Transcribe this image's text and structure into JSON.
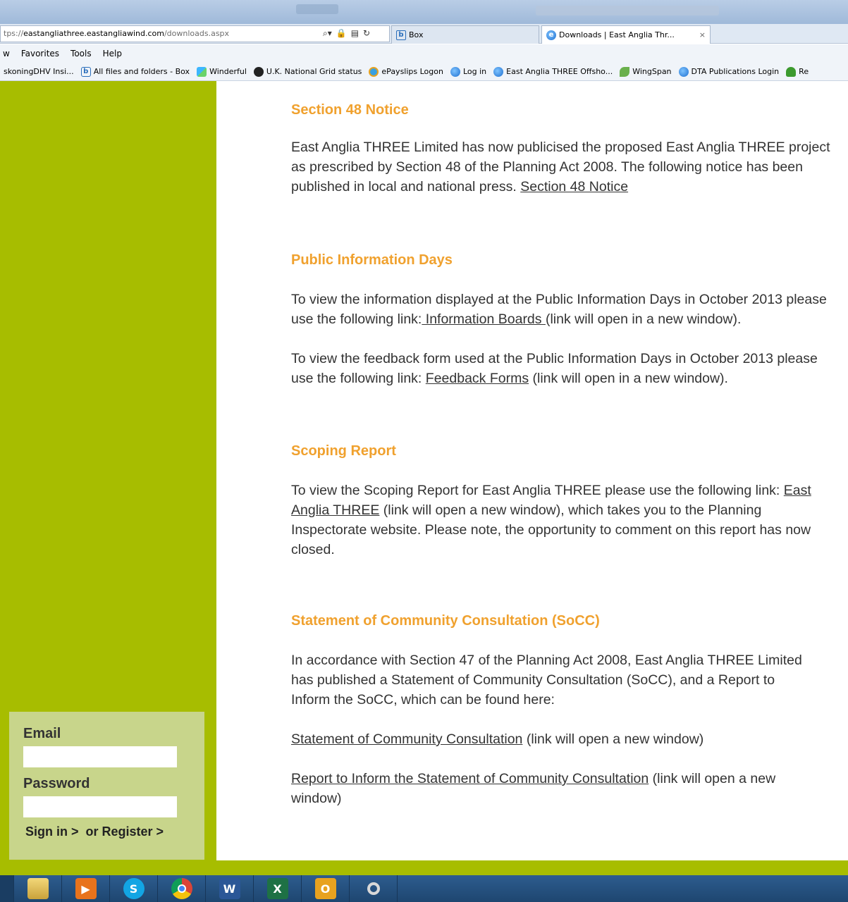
{
  "browser": {
    "address_prefix": "tps://",
    "address_host": "eastangliathree.eastangliawind.com",
    "address_path": "/downloads.aspx",
    "tabs": [
      {
        "label": "Box",
        "icon": "box-icon"
      },
      {
        "label": "Downloads | East Anglia Thr...",
        "icon": "ie-icon",
        "close": "×"
      }
    ],
    "menu": [
      "w",
      "Favorites",
      "Tools",
      "Help"
    ],
    "favorites": [
      {
        "label": "skoningDHV Insi...",
        "icon": ""
      },
      {
        "label": "All files and folders - Box",
        "icon": "box-icon"
      },
      {
        "label": "Winderful",
        "icon": "winderful-icon"
      },
      {
        "label": "U.K. National Grid status",
        "icon": "national-grid-icon"
      },
      {
        "label": "ePayslips Logon",
        "icon": "epayslips-icon"
      },
      {
        "label": "Log in",
        "icon": "ie-icon"
      },
      {
        "label": "East Anglia THREE Offsho...",
        "icon": "ie-icon"
      },
      {
        "label": "WingSpan",
        "icon": "wingspan-icon"
      },
      {
        "label": "DTA Publications  Login",
        "icon": "ie-icon"
      },
      {
        "label": "Re",
        "icon": "tree-icon"
      }
    ]
  },
  "sections": [
    {
      "heading": "Section 48 Notice",
      "paras": [
        {
          "text": "East Anglia THREE Limited has now publicised the proposed East Anglia THREE project as prescribed by Section 48 of the Planning Act 2008. The following notice has been published in local and national press.  ",
          "link": "Section 48 Notice",
          "after": ""
        }
      ]
    },
    {
      "heading": "Public Information Days",
      "paras": [
        {
          "text": "To view the information displayed at the Public Information Days in October 2013 please use the following link:",
          "link": " Information Boards ",
          "after": "(link will open in a new window)."
        },
        {
          "text": "To view the feedback form used at the Public Information Days in October 2013 please use the following link: ",
          "link": "Feedback Forms",
          "after": " (link will open in a new window)."
        }
      ]
    },
    {
      "heading": "Scoping Report",
      "paras": [
        {
          "text": "To view the Scoping Report for East Anglia THREE please use the following link: ",
          "link": "East Anglia THREE",
          "after": " (link will open a new window), which takes you to the Planning Inspectorate website.  Please note, the opportunity to comment on this report has now closed."
        }
      ]
    },
    {
      "heading": "Statement of Community Consultation (SoCC)",
      "paras": [
        {
          "text": "In accordance with Section 47 of the Planning Act 2008, East Anglia THREE Limited has published a Statement of Community Consultation (SoCC), and a Report to Inform the SoCC, which can be found here:",
          "link": "",
          "after": ""
        },
        {
          "text": "",
          "link": "Statement of Community Consultation",
          "after": " (link will open a new window)"
        },
        {
          "text": "",
          "link": "Report to Inform the Statement of Community Consultation",
          "after": " (link will open a new window)"
        }
      ]
    }
  ],
  "login": {
    "email_label": "Email",
    "password_label": "Password",
    "sign_in": "Sign in >",
    "register": "or Register >"
  },
  "taskbar": [
    "explorer-icon",
    "media-player-icon",
    "skype-icon",
    "chrome-icon",
    "word-icon",
    "excel-icon",
    "outlook-icon",
    "search-icon"
  ],
  "colors": {
    "sidebar": "#a7bd00",
    "login_panel": "#c8d58b",
    "heading": "#f0a12e"
  }
}
